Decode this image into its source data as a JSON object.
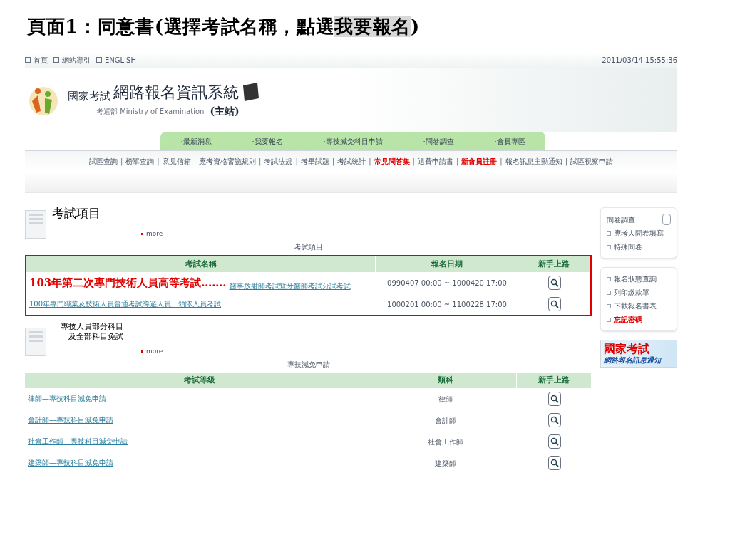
{
  "slide_title": {
    "text": "頁面1：同意書(選擇考試名稱，點選",
    "highlight": "我要報名",
    "end": ")"
  },
  "top_links": [
    "首頁",
    "網站導引",
    "ENGLISH"
  ],
  "datetime": "2011/03/14 15:55:36",
  "logo": {
    "prefix": "國家考試",
    "name": "網路報名資訊系統",
    "ministry": "考選部 Ministry of Examination",
    "site": "(主站)"
  },
  "main_tabs": [
    "·最新消息",
    "·我要報名",
    "·專技減免科目申請",
    "·問卷調查",
    "·會員專區"
  ],
  "sub_nav_separator": "|",
  "sub_nav": [
    {
      "label": "試區查詢",
      "highlight": false
    },
    {
      "label": "榜單查詢",
      "highlight": false
    },
    {
      "label": "意見信箱",
      "highlight": false
    },
    {
      "label": "應考資格審議規則",
      "highlight": false
    },
    {
      "label": "考試法規",
      "highlight": false
    },
    {
      "label": "考畢試題",
      "highlight": false
    },
    {
      "label": "考試統計",
      "highlight": false
    },
    {
      "label": "常見問答集",
      "highlight": true
    },
    {
      "label": "退費申請書",
      "highlight": false
    },
    {
      "label": "新會員註冊",
      "highlight": true
    },
    {
      "label": "報名訊息主動通知",
      "highlight": false
    },
    {
      "label": "試區視察申請",
      "highlight": false
    }
  ],
  "sections": [
    {
      "title": [
        "考試項目"
      ],
      "more": "more",
      "caption": "考試項目",
      "columns": [
        "考試名稱",
        "報名日期",
        "新手上路"
      ],
      "callout": "103年第二次專門技術人員高等考試…….",
      "rows": [
        {
          "name": "醫事放射師考試暨牙醫師考試分試考試",
          "info": "0990407 00:00 ~ 1000420 17:00"
        },
        {
          "name": "100年專門職業及技術人員普通考試導遊人員、領隊人員考試",
          "info": "1000201 00:00 ~ 1100228 17:00"
        }
      ]
    },
    {
      "title": [
        "專技人員部分科目",
        "及全部科目免試"
      ],
      "more": "more",
      "caption": "專技減免申請",
      "columns": [
        "考試等級",
        "類科",
        "新手上路"
      ],
      "rows": [
        {
          "name": "律師—專技科目減免申請",
          "info": "律師"
        },
        {
          "name": "會計師—專技科目減免申請",
          "info": "會計師"
        },
        {
          "name": "社會工作師—專技科目減免申請",
          "info": "社會工作師"
        },
        {
          "name": "建築師—專技科目減免申請",
          "info": "建築師"
        }
      ]
    }
  ],
  "side_boxes": [
    {
      "title": "問卷調查",
      "items": [
        {
          "label": "應考人問卷填寫",
          "highlight": false
        },
        {
          "label": "特殊問卷",
          "highlight": false
        }
      ]
    },
    {
      "items": [
        {
          "label": "報名狀態查詢",
          "highlight": false
        },
        {
          "label": "列印繳款單",
          "highlight": false
        },
        {
          "label": "下載報名書表",
          "highlight": false
        },
        {
          "label": "忘記密碼",
          "highlight": true
        }
      ]
    }
  ],
  "banner": {
    "title": "國家考試",
    "subtitle": "網路報名訊息通知"
  }
}
